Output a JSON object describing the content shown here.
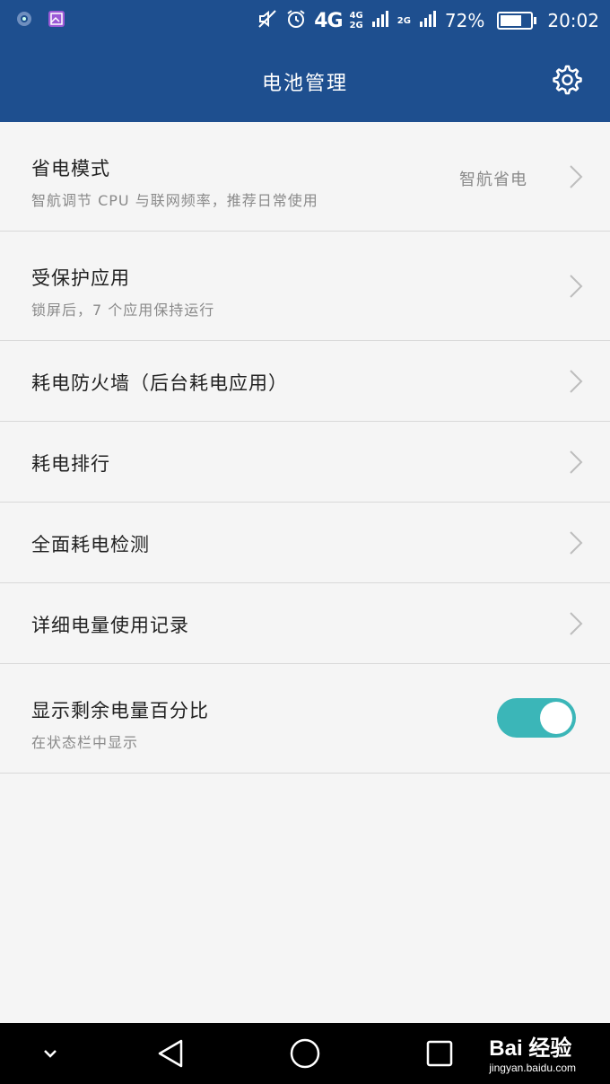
{
  "status_bar": {
    "network_label": "4G",
    "network_small_top": "4G",
    "network_small_bottom": "2G",
    "signal2_label": "2G",
    "battery_percent": "72%",
    "battery_level": 0.72,
    "time": "20:02",
    "icons": [
      "app-icon-1",
      "gallery-icon",
      "mute-icon",
      "alarm-icon",
      "signal-icon",
      "battery-icon"
    ]
  },
  "app_bar": {
    "title": "电池管理",
    "settings_icon": "gear-icon"
  },
  "rows": [
    {
      "title": "省电模式",
      "subtitle": "智航调节 CPU 与联网频率，推荐日常使用",
      "value": "智航省电"
    },
    {
      "title": "受保护应用",
      "subtitle": "锁屏后，7 个应用保持运行"
    },
    {
      "title": "耗电防火墙（后台耗电应用）"
    },
    {
      "title": "耗电排行"
    },
    {
      "title": "全面耗电检测"
    },
    {
      "title": "详细电量使用记录"
    },
    {
      "title": "显示剩余电量百分比",
      "subtitle": "在状态栏中显示",
      "toggle_on": true
    }
  ],
  "nav_bar": {
    "icons": [
      "chevron-down-icon",
      "back-icon",
      "home-icon",
      "recents-icon"
    ]
  },
  "watermark": {
    "main": "Bai 经验",
    "sub": "jingyan.baidu.com"
  },
  "colors": {
    "primary": "#1e4f8f",
    "toggle": "#3bb6b8",
    "background": "#f5f5f5"
  }
}
